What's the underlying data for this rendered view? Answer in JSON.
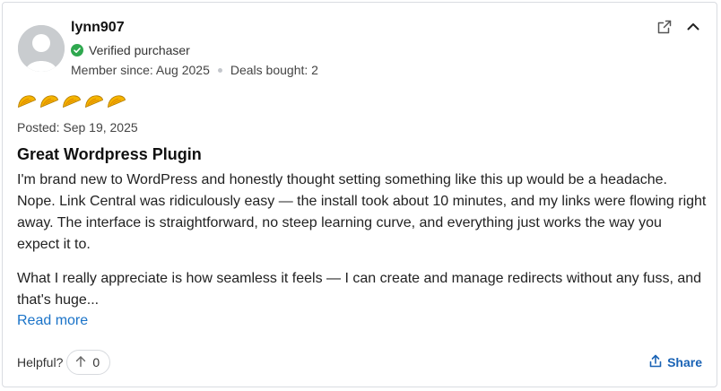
{
  "review": {
    "username": "lynn907",
    "verified_label": "Verified purchaser",
    "member_since": "Member since: Aug 2025",
    "deals_bought": "Deals bought: 2",
    "rating": 5,
    "rating_max": 5,
    "posted": "Posted: Sep 19, 2025",
    "title": "Great Wordpress Plugin",
    "paragraphs": [
      "I'm brand new to WordPress and honestly thought setting something like this up would be a headache. Nope. Link Central was ridiculously easy — the install took about 10 minutes, and my links were flowing right away. The interface is straightforward, no steep learning curve, and everything just works the way you expect it to.",
      "What I really appreciate is how seamless it feels — I can create and manage redirects without any fuss, and that's huge..."
    ],
    "read_more": "Read more"
  },
  "footer": {
    "helpful_label": "Helpful?",
    "helpful_count": "0",
    "share_label": "Share"
  },
  "icons": {
    "external_link": "external-link-icon",
    "collapse": "chevron-up-icon",
    "verified": "check-circle-icon",
    "upvote": "arrow-up-icon",
    "share": "share-upload-icon",
    "rating": "taco-icon"
  },
  "colors": {
    "verified_green": "#2fa84f",
    "link_blue": "#1a73c8",
    "taco_yellow": "#f4b400"
  }
}
